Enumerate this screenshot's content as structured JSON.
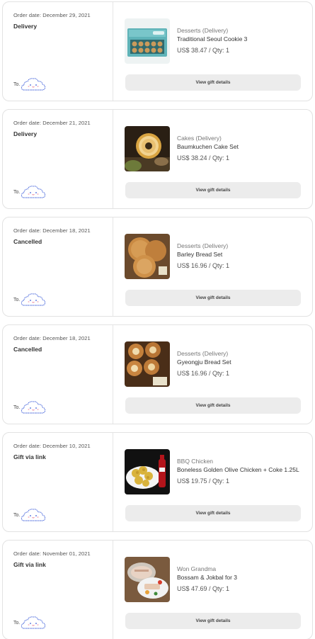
{
  "cloud_icon_color": "#3a5bd9",
  "orders": [
    {
      "order_date": "Order date: December 29, 2021",
      "status": "Delivery",
      "to_label": "To.",
      "category": "Desserts (Delivery)",
      "product_name": "Traditional Seoul Cookie 3",
      "price_qty": "US$ 38.47 / Qty: 1",
      "button_label": "View gift details",
      "image": "teal-cookie-box"
    },
    {
      "order_date": "Order date: December 21, 2021",
      "status": "Delivery",
      "to_label": "To.",
      "category": "Cakes (Delivery)",
      "product_name": "Baumkuchen Cake Set",
      "price_qty": "US$ 38.24 / Qty: 1",
      "button_label": "View gift details",
      "image": "baumkuchen-cake"
    },
    {
      "order_date": "Order date: December 18, 2021",
      "status": "Cancelled",
      "to_label": "To.",
      "category": "Desserts (Delivery)",
      "product_name": "Barley Bread Set",
      "price_qty": "US$ 16.96 / Qty: 1",
      "button_label": "View gift details",
      "image": "barley-bread"
    },
    {
      "order_date": "Order date: December 18, 2021",
      "status": "Cancelled",
      "to_label": "To.",
      "category": "Desserts (Delivery)",
      "product_name": "Gyeongju Bread Set",
      "price_qty": "US$ 16.96 / Qty: 1",
      "button_label": "View gift details",
      "image": "gyeongju-bread"
    },
    {
      "order_date": "Order date: December 10, 2021",
      "status": "Gift via link",
      "to_label": "To.",
      "category": "BBQ Chicken",
      "product_name": "Boneless Golden Olive Chicken + Coke 1.25L",
      "price_qty": "US$ 19.75 / Qty: 1",
      "button_label": "View gift details",
      "image": "fried-chicken-coke"
    },
    {
      "order_date": "Order date: November 01, 2021",
      "status": "Gift via link",
      "to_label": "To.",
      "category": "Won Grandma",
      "product_name": "Bossam & Jokbal for 3",
      "price_qty": "US$ 47.69 / Qty: 1",
      "button_label": "View gift details",
      "image": "bossam-platter"
    }
  ]
}
